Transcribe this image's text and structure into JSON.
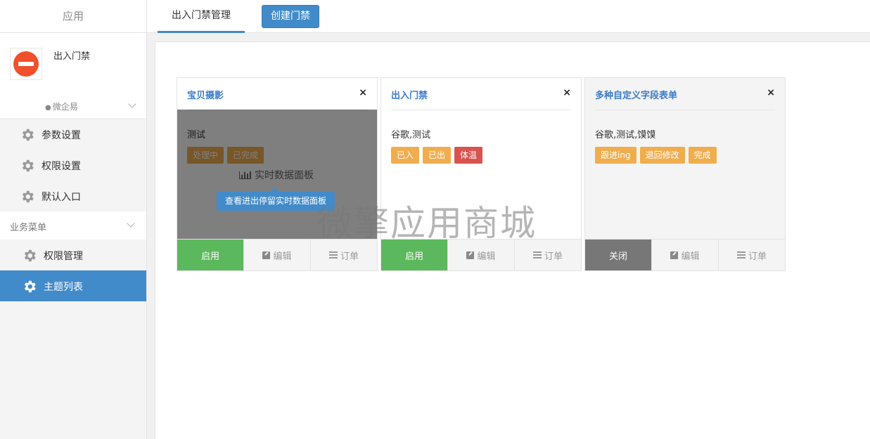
{
  "sidebar": {
    "header": "应用",
    "app_name": "出入门禁",
    "group_label": "微企易",
    "settings": [
      {
        "label": "参数设置"
      },
      {
        "label": "权限设置"
      },
      {
        "label": "默认入口"
      }
    ],
    "section_label": "业务菜单",
    "business": [
      {
        "label": "权限管理"
      },
      {
        "label": "主题列表"
      }
    ]
  },
  "topbar": {
    "tab_label": "出入门禁管理",
    "create_label": "创建门禁"
  },
  "cards": [
    {
      "title": "宝贝摄影",
      "close": "×",
      "desc": "测试",
      "tags": [
        "处理中",
        "已完成"
      ],
      "overlay_title": "实时数据面板",
      "overlay_button": "查看进出停留实时数据面板",
      "status": "启用",
      "edit": "编辑",
      "orders": "订单"
    },
    {
      "title": "出入门禁",
      "close": "×",
      "desc": "谷歌,测试",
      "tags": [
        "已入",
        "已出",
        "体温"
      ],
      "status": "启用",
      "edit": "编辑",
      "orders": "订单"
    },
    {
      "title": "多种自定义字段表单",
      "close": "×",
      "desc": "谷歌,测试,馍馍",
      "tags": [
        "跟进ing",
        "退回修改",
        "完成"
      ],
      "status": "关闭",
      "edit": "编辑",
      "orders": "订单"
    }
  ],
  "watermark": "微擎应用商城",
  "colors": {
    "primary": "#428bca",
    "success": "#5cb85c",
    "warning": "#f0ad4e",
    "danger": "#d9534f",
    "off": "#777777"
  }
}
